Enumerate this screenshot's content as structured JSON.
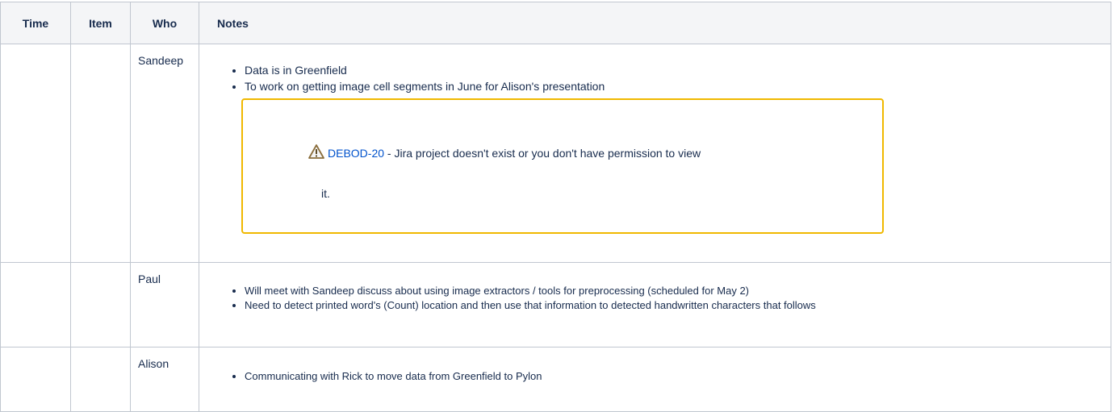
{
  "table": {
    "headers": {
      "time": "Time",
      "item": "Item",
      "who": "Who",
      "notes": "Notes"
    },
    "rows": [
      {
        "time": "",
        "item": "",
        "who": "Sandeep",
        "notes": [
          "Data is in Greenfield",
          "To work on getting image cell segments in June for Alison's presentation"
        ],
        "jira": {
          "icon": "warning-icon",
          "key": "DEBOD-20",
          "message": " - Jira project doesn't exist or you don't have permission to view",
          "message_cont": "it.",
          "border_color": "#f0b800"
        }
      },
      {
        "time": "",
        "item": "",
        "who": "Paul",
        "notes": [
          "Will meet with Sandeep discuss about using image extractors / tools for preprocessing (scheduled for May 2)",
          "Need to detect printed word's (Count) location and then use that information to detected handwritten characters that follows"
        ]
      },
      {
        "time": "",
        "item": "",
        "who": "Alison",
        "notes": [
          "Communicating with Rick to move data from Greenfield to Pylon"
        ]
      }
    ]
  },
  "colors": {
    "header_bg": "#f4f5f7",
    "border": "#c1c7d0",
    "text": "#172b4d",
    "link": "#0052cc",
    "warning": "#f0b800"
  }
}
